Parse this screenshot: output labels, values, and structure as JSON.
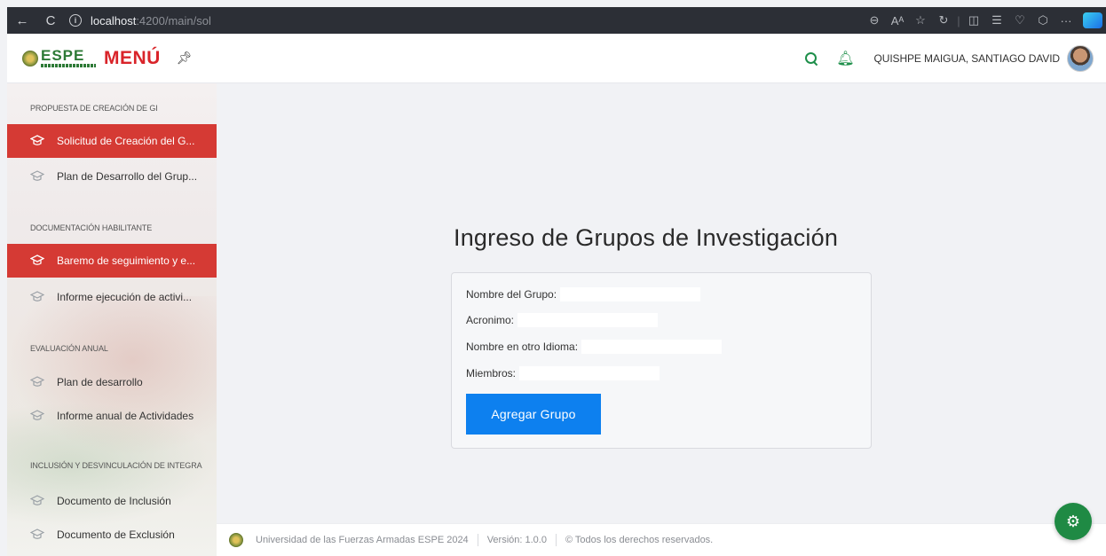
{
  "browser": {
    "back_icon": "←",
    "reload_icon": "C",
    "url_host": "localhost",
    "url_rest": ":4200/main/sol"
  },
  "header": {
    "logo_text": "ESPE",
    "menu_title": "MENÚ",
    "pin_icon": "pin-icon",
    "user_name": "QUISHPE MAIGUA, SANTIAGO DAVID"
  },
  "sidebar": {
    "sections": [
      {
        "title": "PROPUESTA DE CREACIÓN DE GI",
        "items": [
          {
            "label": "Solicitud de Creación del G...",
            "active": true
          },
          {
            "label": "Plan de Desarrollo del Grup...",
            "active": false
          }
        ]
      },
      {
        "title": "DOCUMENTACIÓN HABILITANTE",
        "items": [
          {
            "label": "Baremo de seguimiento y e...",
            "active": true
          },
          {
            "label": "Informe ejecución de activi...",
            "active": false
          }
        ]
      },
      {
        "title": "EVALUACIÓN ANUAL",
        "items": [
          {
            "label": "Plan de desarrollo",
            "active": false
          },
          {
            "label": "Informe anual de Actividades",
            "active": false
          }
        ]
      },
      {
        "title": "INCLUSIÓN Y DESVINCULACIÓN DE INTEGRA",
        "items": [
          {
            "label": "Documento de Inclusión",
            "active": false
          },
          {
            "label": "Documento de Exclusión",
            "active": false
          }
        ]
      }
    ]
  },
  "main": {
    "title": "Ingreso de Grupos de Investigación",
    "form": {
      "group_name_label": "Nombre del Grupo:",
      "group_name_value": "",
      "acronym_label": "Acronimo:",
      "acronym_value": "",
      "other_lang_label": "Nombre en otro Idioma:",
      "other_lang_value": "",
      "members_label": "Miembros:",
      "members_value": "",
      "submit_label": "Agregar Grupo"
    }
  },
  "footer": {
    "university": "Universidad de las Fuerzas Armadas ESPE 2024",
    "version": "Versión: 1.0.0",
    "rights": "© Todos los derechos reservados."
  },
  "colors": {
    "brand_green": "#2d7a36",
    "menu_red": "#d9242a",
    "active_item": "#d53a34",
    "primary_button": "#0d80ef",
    "fab_green": "#1f8a44"
  }
}
